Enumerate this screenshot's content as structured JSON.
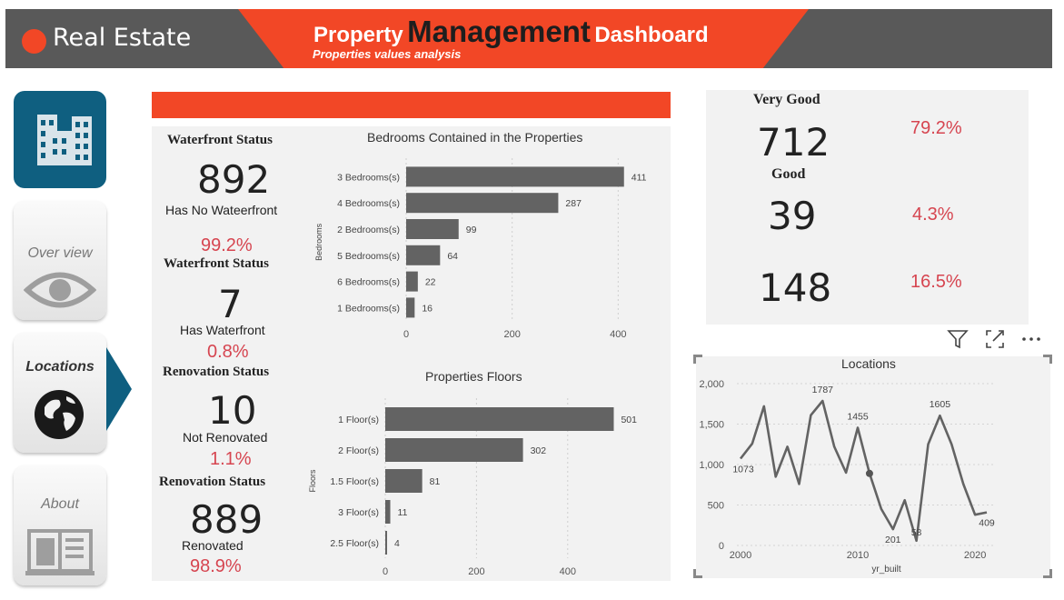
{
  "header": {
    "brand": "Real Estate",
    "title_part1": "Property",
    "title_part2": "Management",
    "title_part3": "Dashboard",
    "subtitle": "Properties values analysis",
    "accent_color": "#f24726",
    "bar_color": "#595959"
  },
  "nav": {
    "items": [
      {
        "label": "Over view",
        "icon": "eye-icon"
      },
      {
        "label": "Locations",
        "icon": "globe-icon",
        "active": true
      },
      {
        "label": "About",
        "icon": "book-icon"
      }
    ],
    "top_icon": "buildings-icon"
  },
  "kpis": {
    "waterfront_head_1": "Waterfront Status",
    "no_waterfront_value": "892",
    "no_waterfront_label": "Has No Wateerfront",
    "no_waterfront_pct": "99.2%",
    "waterfront_head_2": "Waterfront Status",
    "waterfront_value": "7",
    "waterfront_label": "Has Waterfront",
    "waterfront_pct": "0.8%",
    "renovation_head_1": "Renovation Status",
    "not_renovated_value": "10",
    "not_renovated_label": "Not Renovated",
    "not_renovated_pct": "1.1%",
    "renovation_head_2": "Renovation Status",
    "renovated_value": "889",
    "renovated_label": "Renovated",
    "renovated_pct": "98.9%"
  },
  "condition": {
    "very_good_label": "Very Good",
    "very_good_value": "712",
    "very_good_pct": "79.2%",
    "good_label": "Good",
    "good_value": "39",
    "good_pct": "4.3%",
    "other_value": "148",
    "other_pct": "16.5%"
  },
  "toolbar": {
    "filter_icon": "filter-icon",
    "focus_icon": "focus-mode-icon",
    "more_icon": "more-options-icon"
  },
  "chart_data": [
    {
      "type": "bar",
      "orientation": "horizontal",
      "title": "Bedrooms Contained in the Properties",
      "ylabel": "Bedrooms",
      "categories": [
        "3 Bedrooms(s)",
        "4 Bedrooms(s)",
        "2 Bedrooms(s)",
        "5 Bedrooms(s)",
        "6 Bedrooms(s)",
        "1 Bedrooms(s)"
      ],
      "values": [
        411,
        287,
        99,
        64,
        22,
        16
      ],
      "xlim": [
        0,
        420
      ],
      "xticks": [
        0,
        200,
        400
      ],
      "color": "#636363"
    },
    {
      "type": "bar",
      "orientation": "horizontal",
      "title": "Properties Floors",
      "ylabel": "Floors",
      "categories": [
        "1 Floor(s)",
        "2 Floor(s)",
        "1.5 Floor(s)",
        "3 Floor(s)",
        "2.5 Floor(s)"
      ],
      "values": [
        501,
        302,
        81,
        11,
        4
      ],
      "xlim": [
        0,
        510
      ],
      "xticks": [
        0,
        200,
        400
      ],
      "color": "#636363"
    },
    {
      "type": "line",
      "title": "Locations",
      "xlabel": "yr_built",
      "x": [
        2000,
        2001,
        2002,
        2003,
        2004,
        2005,
        2006,
        2007,
        2008,
        2009,
        2010,
        2011,
        2012,
        2013,
        2014,
        2015,
        2016,
        2017,
        2018,
        2019,
        2020,
        2021
      ],
      "y": [
        1073,
        1260,
        1720,
        850,
        1220,
        760,
        1610,
        1787,
        1220,
        900,
        1455,
        890,
        450,
        201,
        560,
        58,
        1250,
        1605,
        1250,
        760,
        380,
        409
      ],
      "labels": [
        {
          "index": 0,
          "text": "1073"
        },
        {
          "index": 7,
          "text": "1787"
        },
        {
          "index": 10,
          "text": "1455"
        },
        {
          "index": 13,
          "text": "201"
        },
        {
          "index": 15,
          "text": "58"
        },
        {
          "index": 17,
          "text": "1605"
        },
        {
          "index": 21,
          "text": "409"
        }
      ],
      "highlight_index": 11,
      "xlim": [
        2000,
        2021
      ],
      "ylim": [
        0,
        2000
      ],
      "xticks": [
        2000,
        2010,
        2020
      ],
      "yticks": [
        0,
        500,
        1000,
        1500,
        2000
      ],
      "ytick_labels": [
        "0",
        "500",
        "1,000",
        "1,500",
        "2,000"
      ],
      "color": "#636363"
    }
  ]
}
